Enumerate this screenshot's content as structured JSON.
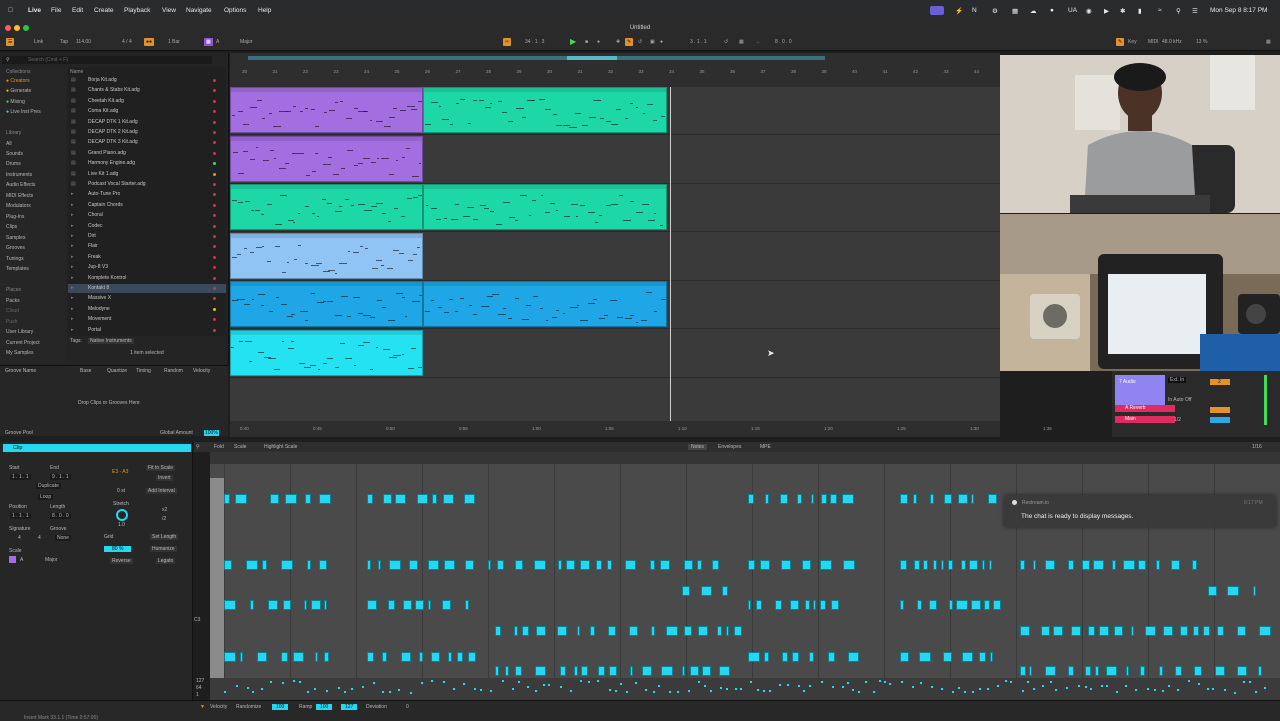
{
  "menubar": {
    "apple": "",
    "app": "Live",
    "items": [
      "File",
      "Edit",
      "Create",
      "Playback",
      "View",
      "Navigate",
      "Options",
      "Help"
    ],
    "datetime": "Mon Sep 8  8:17 PM"
  },
  "window": {
    "title": "Untitled"
  },
  "transport": {
    "link": "Link",
    "tap": "Tap",
    "tempo": "114.00",
    "signature": "4 / 4",
    "quantize": "1 Bar",
    "key": "A",
    "scale": "Major",
    "position": "34 .  1 .  3",
    "loop_start": "3 .  1 .  1",
    "loop_len": "8 .  0 .  0",
    "key_label": "Key",
    "midi_label": "MIDI",
    "sample_rate": "48.0 kHz",
    "cpu": "13 %"
  },
  "browser": {
    "search_placeholder": "Search (Cmd + F)",
    "collections_header": "Collections",
    "collections": [
      "Creators",
      "Generate",
      "Mixing",
      "Live Inst Pres"
    ],
    "library_header": "Library",
    "library": [
      "All",
      "Sounds",
      "Drums",
      "Instruments",
      "Audio Effects",
      "MIDI Effects",
      "Modulators",
      "Plug-Ins",
      "Clips",
      "Samples",
      "Grooves",
      "Tunings",
      "Templates"
    ],
    "places_header": "Places",
    "places": [
      "Packs",
      "Cloud",
      "Push",
      "User Library",
      "Current Project",
      "My Samples"
    ],
    "name_header": "Name",
    "files": [
      "Borja Kit.adg",
      "Chants & Stabs Kit.adg",
      "Cheetah Kit.adg",
      "Coma Kit.adg",
      "DECAP DTK 1 Kit.adg",
      "DECAP DTK 2 Kit.adg",
      "DECAP DTK 3 Kit.adg",
      "Grand Piano.adg",
      "Harmony Engine.adg",
      "Live Kit 1.adg",
      "Podcast Vocal Starter.adg",
      "Auto-Tune Pro",
      "Captain Chords",
      "Choral",
      "Codec",
      "Dirt",
      "Flair",
      "Freak",
      "Jup-8 V3",
      "Komplete Kontrol",
      "Kontakt 8",
      "Massive X",
      "Melodyne",
      "Movement",
      "Portal"
    ],
    "tags_label": "Tags:",
    "tags_value": "Native Instruments",
    "selected_count": "1 item selected"
  },
  "groove": {
    "headers": [
      "Groove Name",
      "Base",
      "Quantize",
      "Timing",
      "Random",
      "Velocity"
    ],
    "drop_hint": "Drop Clips or Grooves Here",
    "pool_label": "Groove Pool",
    "global_amount_label": "Global Amount",
    "global_amount": "100%"
  },
  "ruler": {
    "bars": [
      "20",
      "21",
      "22",
      "23",
      "24",
      "25",
      "26",
      "27",
      "28",
      "29",
      "30",
      "31",
      "32",
      "33",
      "34",
      "35",
      "36",
      "37",
      "38",
      "39",
      "40",
      "41",
      "42",
      "43",
      "44"
    ],
    "times": [
      "0:40",
      "0:45",
      "0:50",
      "0:55",
      "1:00",
      "1:05",
      "1:10",
      "1:15",
      "1:20",
      "1:25",
      "1:30",
      "1:35"
    ]
  },
  "mixer": {
    "track_name": "7 Audio",
    "input": "Ext. In",
    "monitor": "In  Auto  Off",
    "return_a": "A Reverb",
    "main": "Main",
    "routing": "1/2",
    "number": "2"
  },
  "clip": {
    "title": "Clip",
    "start_label": "Start",
    "end_label": "End",
    "start": "1 . 1 . 1",
    "end": "9 . 1 . 1",
    "duplicate": "Duplicate",
    "loop": "Loop",
    "position_label": "Position",
    "length_label": "Length",
    "position": "1 . 1 . 1",
    "length": "8 . 0 . 0",
    "signature_label": "Signature",
    "groove_label": "Groove",
    "sig_num": "4",
    "sig_den": "4",
    "groove_value": "None",
    "scale_label": "Scale",
    "scale_key": "A",
    "scale_mode": "Major",
    "range": "E3 - A3",
    "fit_to_scale": "Fit to Scale",
    "invert": "Invert",
    "stretch_value": "0 st",
    "add_interval": "Add Interval",
    "stretch_label": "Stretch",
    "x2": "x2",
    "div2": "/2",
    "stretch_amount": "1.0",
    "grid_label": "Grid",
    "set_length": "Set Length",
    "grid_value": "80 %",
    "humanize": "Humanize",
    "reverse": "Reverse",
    "legato": "Legato"
  },
  "pianoroll": {
    "fold": "Fold",
    "scale": "Scale",
    "highlight_scale": "Highlight Scale",
    "tabs": [
      "Notes",
      "Envelopes",
      "MPE"
    ],
    "grid_readout": "1/16",
    "pitch_label": "C3",
    "vel_values": [
      "127",
      "64",
      "1"
    ]
  },
  "statusbar": {
    "velocity_label": "Velocity",
    "randomize_label": "Randomize",
    "randomize_value": "100",
    "ramp_label": "Ramp",
    "ramp_a": "100",
    "ramp_b": "127",
    "deviation_label": "Deviation",
    "deviation_value": "0",
    "info": "Insert Mark 33.1.1 (Time 0:57:00)"
  },
  "toast": {
    "source": "Restream.io",
    "message": "The chat is ready to display messages.",
    "time": "8:17 PM"
  },
  "colors": {
    "purple": "#a36ee0",
    "teal": "#1ed7a6",
    "light_blue": "#8fc4f5",
    "blue": "#1ea6e6",
    "cyan": "#25e2f3",
    "orange": "#e3922a"
  }
}
